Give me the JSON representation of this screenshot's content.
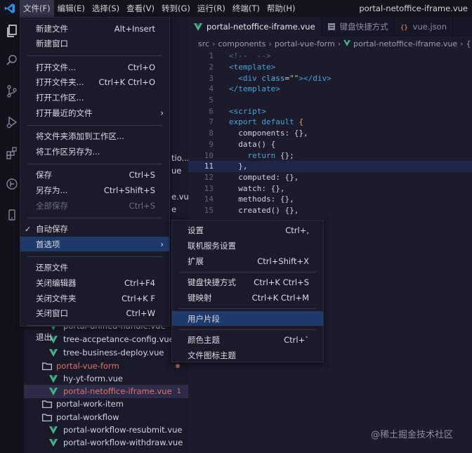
{
  "menubar": {
    "items": [
      "文件(F)",
      "编辑(E)",
      "选择(S)",
      "查看(V)",
      "转到(G)",
      "运行(R)",
      "终端(T)",
      "帮助(H)"
    ],
    "window_title": "portal-netoffice-iframe.vue"
  },
  "tabs": [
    {
      "label": "portal-netoffice-iframe.vue",
      "active": true
    },
    {
      "label": "键盘快捷方式",
      "active": false
    },
    {
      "label": "vue.json",
      "active": false
    }
  ],
  "breadcrumb": [
    "src",
    "components",
    "portal-vue-form",
    "portal-netoffice-iframe.vue",
    "{ } \"por"
  ],
  "code_lines": [
    {
      "n": "1",
      "text": "<!--  -->"
    },
    {
      "n": "2",
      "text": "<template>"
    },
    {
      "n": "3",
      "text": "  <div class=\"\"></div>"
    },
    {
      "n": "4",
      "text": "</template>"
    },
    {
      "n": "5",
      "text": ""
    },
    {
      "n": "6",
      "text": "<script>"
    },
    {
      "n": "7",
      "text": "export default {"
    },
    {
      "n": "8",
      "text": "  components: {},"
    },
    {
      "n": "9",
      "text": "  data() {"
    },
    {
      "n": "10",
      "text": "    return {};"
    },
    {
      "n": "11",
      "text": "  },"
    },
    {
      "n": "12",
      "text": "  computed: {},"
    },
    {
      "n": "13",
      "text": "  watch: {},"
    },
    {
      "n": "14",
      "text": "  methods: {},"
    },
    {
      "n": "15",
      "text": "  created() {},"
    }
  ],
  "sidebar": {
    "peek_texts": [
      "tio...",
      "ue",
      "e.vue",
      "e"
    ],
    "tree": [
      {
        "label": "portal-unified-handle.vue",
        "type": "vue"
      },
      {
        "label": "tree-accpetance-config.vue",
        "type": "vue"
      },
      {
        "label": "tree-business-deploy.vue",
        "type": "vue"
      },
      {
        "label": "portal-vue-form",
        "type": "folder",
        "modified": true
      },
      {
        "label": "hy-yt-form.vue",
        "type": "vue"
      },
      {
        "label": "portal-netoffice-iframe.vue",
        "type": "vue",
        "modified": true,
        "selected": true,
        "badge": "1"
      },
      {
        "label": "portal-work-item",
        "type": "folder"
      },
      {
        "label": "portal-workflow",
        "type": "folder"
      },
      {
        "label": "portal-workflow-resubmit.vue",
        "type": "vue"
      },
      {
        "label": "portal-workflow-withdraw.vue",
        "type": "vue"
      }
    ]
  },
  "file_menu": [
    {
      "label": "新建文件",
      "key": "Alt+Insert"
    },
    {
      "label": "新建窗口",
      "key": ""
    },
    {
      "sep": true
    },
    {
      "label": "打开文件...",
      "key": "Ctrl+O"
    },
    {
      "label": "打开文件夹...",
      "key": "Ctrl+K Ctrl+O"
    },
    {
      "label": "打开工作区...",
      "key": ""
    },
    {
      "label": "打开最近的文件",
      "key": "",
      "submenu": true
    },
    {
      "sep": true
    },
    {
      "label": "将文件夹添加到工作区...",
      "key": ""
    },
    {
      "label": "将工作区另存为...",
      "key": ""
    },
    {
      "sep": true
    },
    {
      "label": "保存",
      "key": "Ctrl+S"
    },
    {
      "label": "另存为...",
      "key": "Ctrl+Shift+S"
    },
    {
      "label": "全部保存",
      "key": "Ctrl+S",
      "disabled": true
    },
    {
      "sep": true
    },
    {
      "label": "自动保存",
      "key": "",
      "checked": true
    },
    {
      "label": "首选项",
      "key": "",
      "submenu": true,
      "active": true
    },
    {
      "sep": true
    },
    {
      "label": "还原文件",
      "key": ""
    },
    {
      "label": "关闭编辑器",
      "key": "Ctrl+F4"
    },
    {
      "label": "关闭文件夹",
      "key": "Ctrl+K F"
    },
    {
      "label": "关闭窗口",
      "key": "Ctrl+W"
    },
    {
      "sep": true
    },
    {
      "label": "退出",
      "key": ""
    }
  ],
  "prefs_menu": [
    {
      "label": "设置",
      "key": "Ctrl+,"
    },
    {
      "label": "联机服务设置",
      "key": ""
    },
    {
      "label": "扩展",
      "key": "Ctrl+Shift+X"
    },
    {
      "sep": true
    },
    {
      "label": "键盘快捷方式",
      "key": "Ctrl+K Ctrl+S"
    },
    {
      "label": "键映射",
      "key": "Ctrl+K Ctrl+M"
    },
    {
      "sep": true
    },
    {
      "label": "用户片段",
      "key": "",
      "active": true
    },
    {
      "sep": true
    },
    {
      "label": "颜色主题",
      "key": "Ctrl+`"
    },
    {
      "label": "文件图标主题",
      "key": ""
    }
  ],
  "watermark": "@稀土掘金技术社区",
  "colors": {
    "menu_highlight": "#1e3a6b",
    "vue_green": "#41b883",
    "modified_red": "#e0716b"
  }
}
